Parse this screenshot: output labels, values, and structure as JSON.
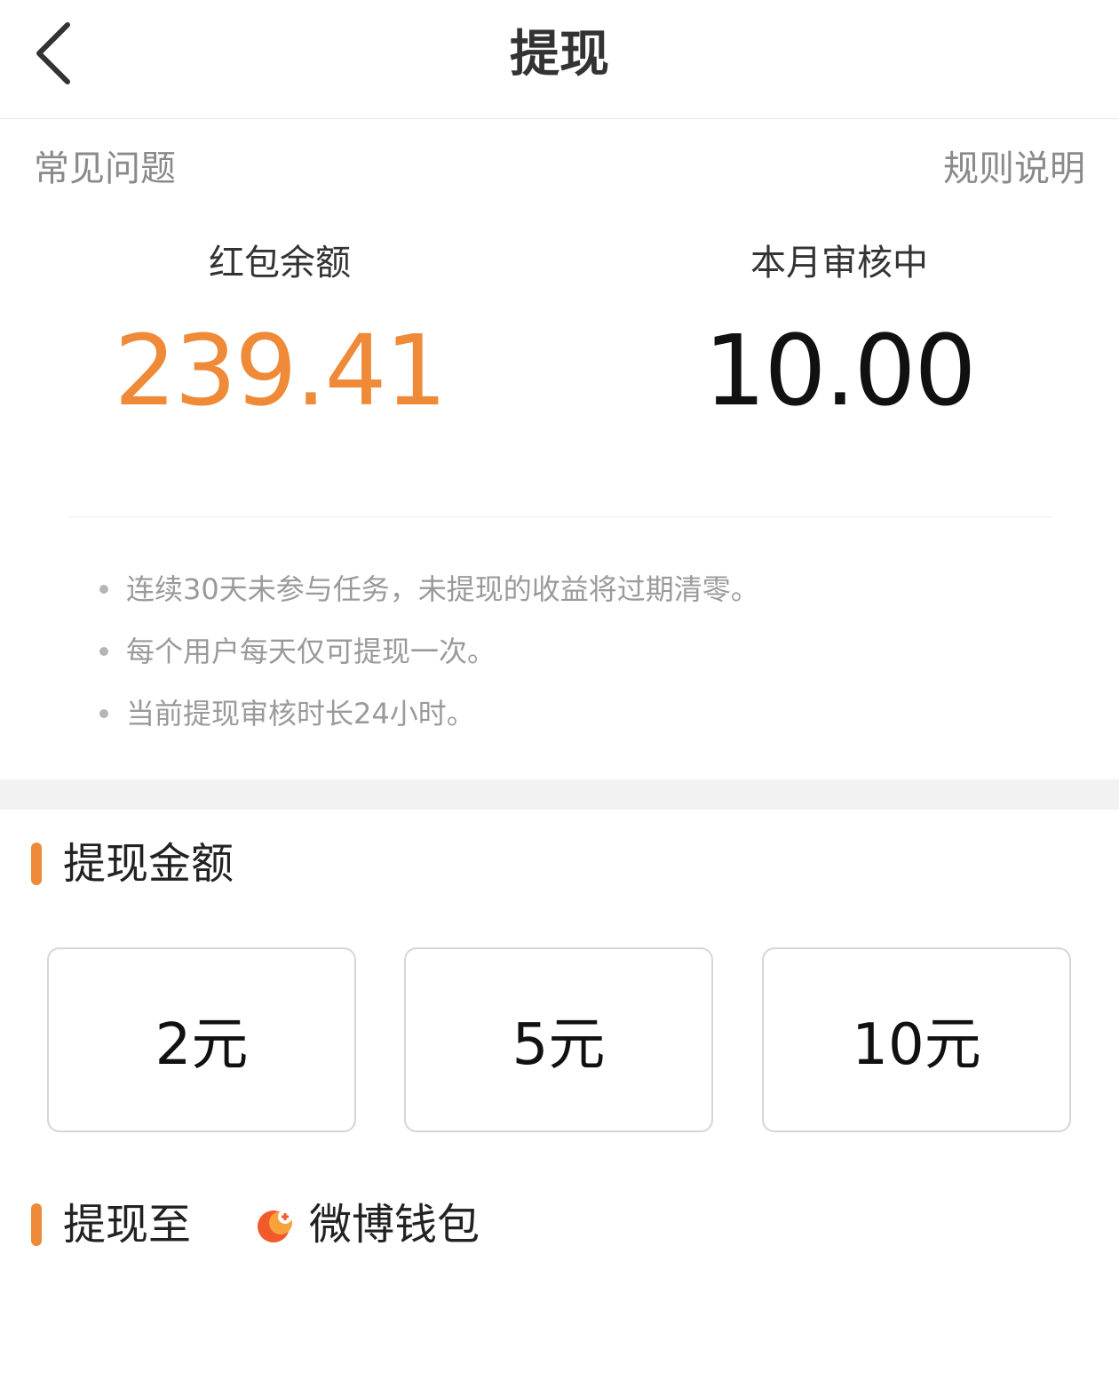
{
  "header": {
    "title": "提现"
  },
  "links": {
    "faq": "常见问题",
    "rules": "规则说明"
  },
  "stats": {
    "balance_label": "红包余额",
    "balance_value": "239.41",
    "pending_label": "本月审核中",
    "pending_value": "10.00"
  },
  "notes": [
    "连续30天未参与任务，未提现的收益将过期清零。",
    "每个用户每天仅可提现一次。",
    "当前提现审核时长24小时。"
  ],
  "amount_section": {
    "title": "提现金额",
    "options": [
      "2元",
      "5元",
      "10元"
    ]
  },
  "destination_section": {
    "title": "提现至",
    "wallet_label": "微博钱包",
    "wallet_icon": "weibo-wallet-icon"
  },
  "colors": {
    "accent": "#ee8a38",
    "text_primary": "#333333",
    "text_secondary": "#9a9a9a",
    "divider": "#f2f2f2"
  }
}
